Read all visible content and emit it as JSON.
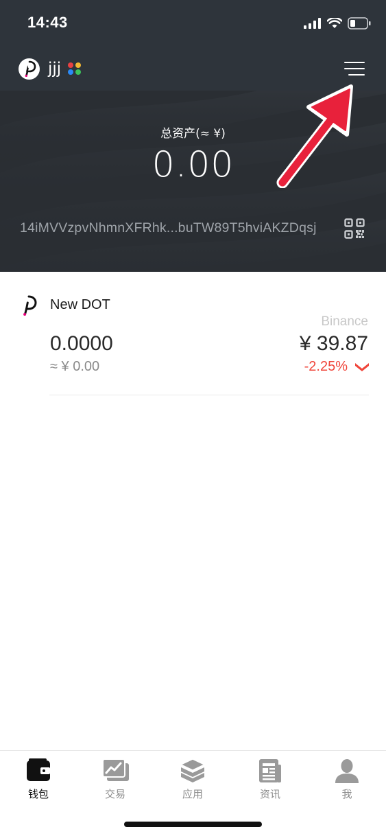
{
  "status_bar": {
    "time": "14:43"
  },
  "header": {
    "wallet_name": "jjj",
    "dot_colors": [
      "#e84142",
      "#f2b733",
      "#2b8af7",
      "#3cc45b"
    ],
    "total_assets_label": "总资产(≈ ¥)",
    "total_assets_value": "0.00",
    "address": "14iMVVzpvNhmnXFRhk...buTW89T5hviAKZDqsj",
    "menu_icon": "hamburger-menu-icon",
    "qr_icon": "qr-code-icon"
  },
  "assets": [
    {
      "name": "New DOT",
      "icon": "polkadot-icon",
      "balance": "0.0000",
      "balance_fiat": "≈ ¥ 0.00",
      "price_source": "Binance",
      "price": "¥ 39.87",
      "change": "-2.25%",
      "change_color": "#f0453a"
    }
  ],
  "tabs": [
    {
      "label": "钱包",
      "icon": "wallet-icon",
      "active": true
    },
    {
      "label": "交易",
      "icon": "chart-icon",
      "active": false
    },
    {
      "label": "应用",
      "icon": "layers-icon",
      "active": false
    },
    {
      "label": "资讯",
      "icon": "news-icon",
      "active": false
    },
    {
      "label": "我",
      "icon": "person-icon",
      "active": false
    }
  ],
  "colors": {
    "header_bg": "#2e343b",
    "accent_red": "#f0453a",
    "arrow": "#e8213b"
  }
}
